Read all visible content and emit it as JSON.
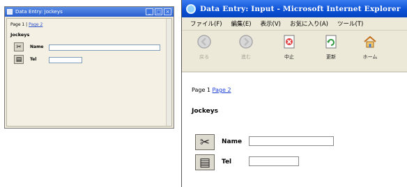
{
  "small_window": {
    "title": "Data Entry: Jockeys",
    "controls": {
      "minimize": "_",
      "maximize": "□",
      "close": "×"
    },
    "nav": {
      "current_page": "Page 1",
      "separator": " | ",
      "next_page_link": "Page 2"
    },
    "heading": "Jockeys",
    "rows": [
      {
        "icon": "scissors-icon",
        "glyph": "✂",
        "label": "Name",
        "value": ""
      },
      {
        "icon": "form-icon",
        "glyph": "▤",
        "label": "Tel",
        "value": ""
      }
    ]
  },
  "browser_window": {
    "title": "Data Entry: Input - Microsoft Internet Explorer",
    "menu": [
      "ファイル(F)",
      "編集(E)",
      "表示(V)",
      "お気に入り(A)",
      "ツール(T)"
    ],
    "toolbar": [
      {
        "label": "戻る",
        "icon": "back-icon",
        "enabled": false
      },
      {
        "label": "進む",
        "icon": "forward-icon",
        "enabled": false
      },
      {
        "label": "中止",
        "icon": "stop-icon",
        "enabled": true
      },
      {
        "label": "更新",
        "icon": "refresh-icon",
        "enabled": true
      },
      {
        "label": "ホーム",
        "icon": "home-icon",
        "enabled": true
      }
    ],
    "nav": {
      "current_page": "Page 1",
      "next_page_link": "Page 2"
    },
    "heading": "Jockeys",
    "rows": [
      {
        "icon": "scissors-icon",
        "glyph": "✂",
        "label": "Name",
        "value": ""
      },
      {
        "icon": "form-icon",
        "glyph": "▤",
        "label": "Tel",
        "value": ""
      }
    ]
  },
  "colors": {
    "xp_title_blue": "#0a4fd4",
    "chrome_beige": "#ece9d8",
    "link_blue": "#1a3fd6"
  }
}
